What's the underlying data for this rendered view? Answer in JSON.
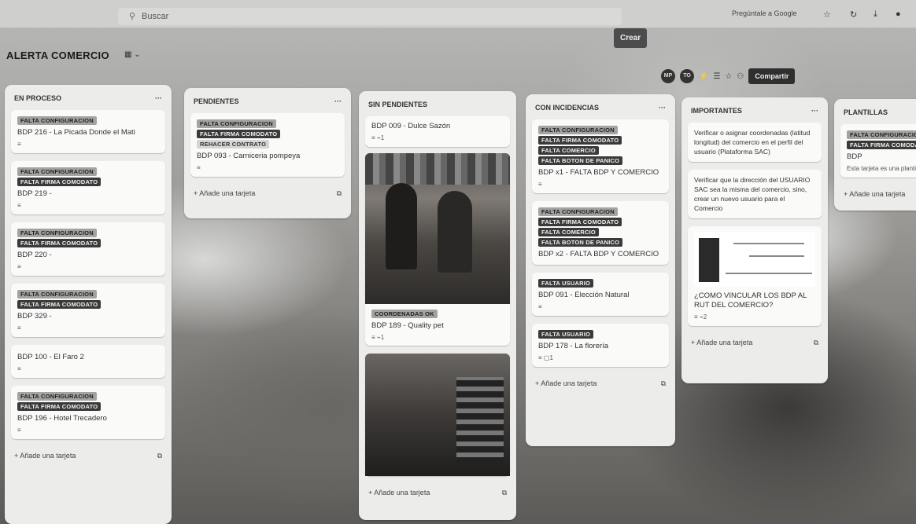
{
  "top": {
    "search_label": "Buscar",
    "ask_google": "Pregúntale a Google",
    "crear": "Crear"
  },
  "board": {
    "title": "ALERTA COMERCIO",
    "view_icon": "board-icon",
    "share_label": "Compartir",
    "avatars": [
      "MP",
      "TO"
    ]
  },
  "columns": [
    {
      "title": "EN PROCESO",
      "cards": [
        {
          "labels": [
            "FALTA CONFIGURACION"
          ],
          "title": "BDP 216 - La Picada Donde el Mati"
        },
        {
          "labels": [
            "FALTA CONFIGURACION",
            "FALTA FIRMA COMODATO"
          ],
          "title": "BDP 219 -"
        },
        {
          "labels": [
            "FALTA CONFIGURACION",
            "FALTA FIRMA COMODATO"
          ],
          "title": "BDP 220 -"
        },
        {
          "labels": [
            "FALTA CONFIGURACION",
            "FALTA FIRMA COMODATO"
          ],
          "title": "BDP 329 -"
        },
        {
          "labels": [],
          "title": "BDP 100 - El Faro 2"
        },
        {
          "labels": [
            "FALTA CONFIGURACION",
            "FALTA FIRMA COMODATO"
          ],
          "title": "BDP 196 - Hotel Trecadero"
        }
      ],
      "add": "Añade una tarjeta"
    },
    {
      "title": "PENDIENTES",
      "cards": [
        {
          "labels": [
            "FALTA CONFIGURACION",
            "FALTA FIRMA COMODATO",
            "REHACER CONTRATO"
          ],
          "title": "BDP 093 - Carniceria pompeya"
        }
      ],
      "add": "Añade una tarjeta"
    },
    {
      "title": "SIN PENDIENTES",
      "cards": [
        {
          "labels": [],
          "title": "BDP 009 - Dulce Sazón",
          "meta": "1"
        },
        {
          "labels": [
            "COORDENADAS OK"
          ],
          "title": "BDP 189 - Quality pet",
          "meta": "1"
        }
      ],
      "add": "Añade una tarjeta"
    },
    {
      "title": "CON INCIDENCIAS",
      "cards": [
        {
          "labels": [
            "FALTA CONFIGURACION",
            "FALTA FIRMA COMODATO",
            "FALTA COMERCIO",
            "FALTA BOTON DE PANICO"
          ],
          "title": "BDP x1 - FALTA BDP Y COMERCIO"
        },
        {
          "labels": [
            "FALTA CONFIGURACION",
            "FALTA FIRMA COMODATO",
            "FALTA COMERCIO",
            "FALTA BOTON DE PANICO"
          ],
          "title": "BDP x2 - FALTA BDP Y COMERCIO"
        },
        {
          "labels": [
            "FALTA USUARIO"
          ],
          "title": "BDP 091 - Elección Natural"
        },
        {
          "labels": [
            "FALTA USUARIO"
          ],
          "title": "BDP 178 - La florería",
          "meta": "1"
        }
      ],
      "add": "Añade una tarjeta"
    },
    {
      "title": "IMPORTANTES",
      "cards": [
        {
          "title": "Verificar o asignar coordenadas (latitud longitud) del comercio en el perfil del usuario (Plataforma SAC)"
        },
        {
          "title": "Verificar que la dirección del USUARIO SAC sea la misma del comercio, sino, crear un nuevo usuario para el Comercio"
        },
        {
          "title": "¿COMO VINCULAR LOS BDP AL RUT DEL COMERCIO?",
          "meta": "2"
        }
      ],
      "add": "Añade una tarjeta"
    },
    {
      "title": "PLANTILLAS",
      "cards": [
        {
          "labels": [
            "FALTA CONFIGURACION",
            "FALTA FIRMA COMODATO"
          ],
          "title": "BDP",
          "meta": "Esta tarjeta es una plantilla"
        }
      ],
      "add": "Añade una tarjeta"
    }
  ]
}
